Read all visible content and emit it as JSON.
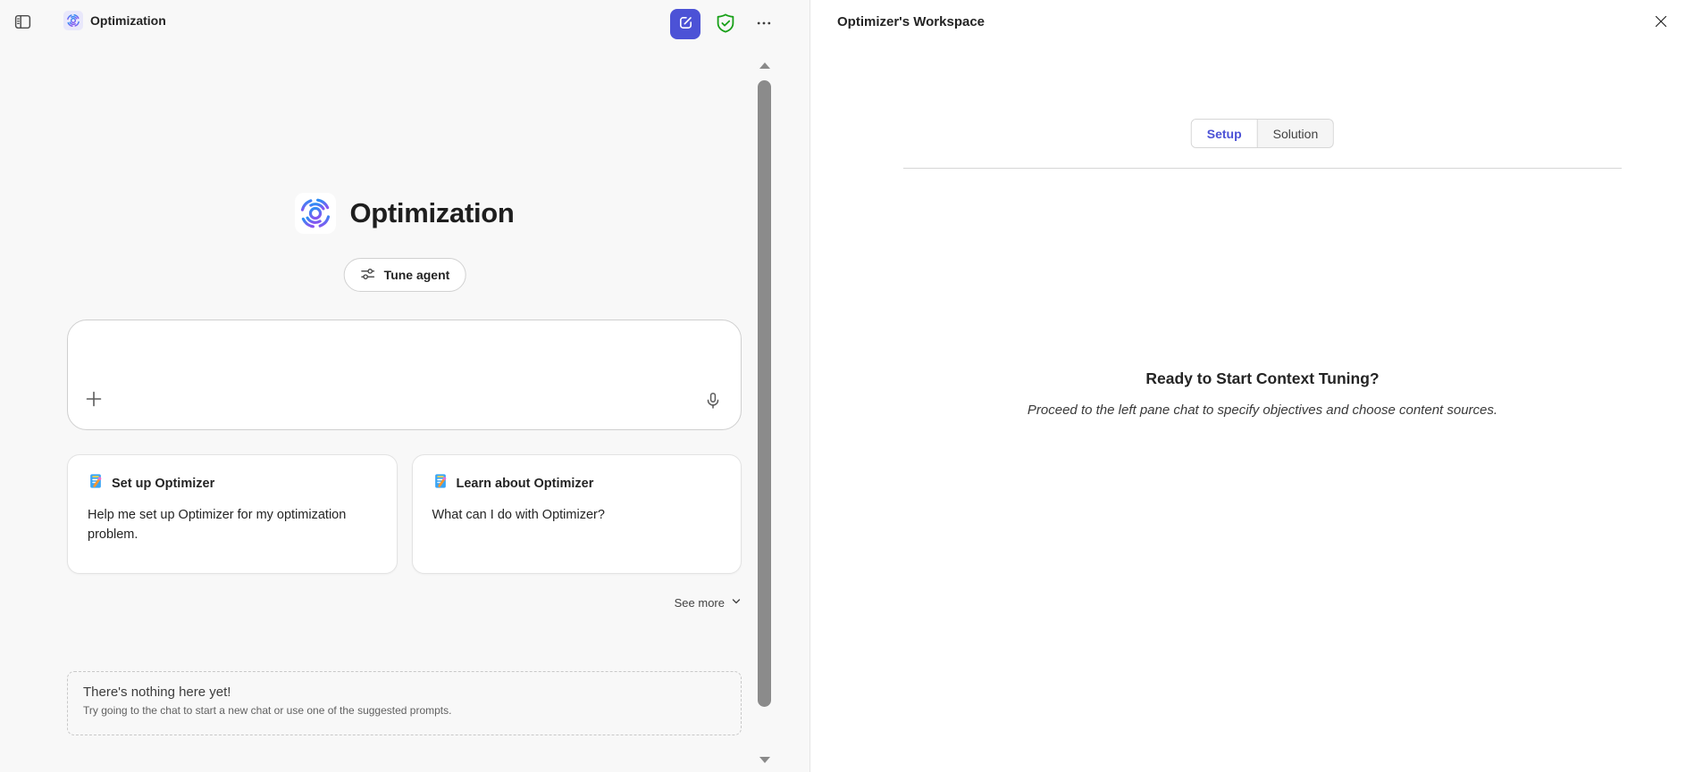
{
  "header": {
    "title": "Optimization"
  },
  "main": {
    "agent_title": "Optimization",
    "tune_agent_label": "Tune agent",
    "suggestions": [
      {
        "title": "Set up Optimizer",
        "body": "Help me set up Optimizer for my optimization problem."
      },
      {
        "title": "Learn about Optimizer",
        "body": "What can I do with Optimizer?"
      }
    ],
    "see_more_label": "See more",
    "empty_state": {
      "title": "There's nothing here yet!",
      "subtitle": "Try going to the chat to start a new chat or use one of the suggested prompts."
    }
  },
  "workspace": {
    "title": "Optimizer's Workspace",
    "tabs": [
      {
        "label": "Setup",
        "active": true
      },
      {
        "label": "Solution",
        "active": false
      }
    ],
    "ready_title": "Ready to Start Context Tuning?",
    "ready_subtitle": "Proceed to the left pane chat to specify objectives and choose content sources."
  },
  "icons": {
    "sidebar_toggle": "panel-left-icon",
    "agent": "gradient-swirl-icon",
    "new_chat": "compose-pencil-icon",
    "shield": "shield-checkmark-icon",
    "more": "ellipsis-icon",
    "tune": "sliders-icon",
    "plus": "plus-icon",
    "mic": "microphone-icon",
    "suggestion": "memo-clipboard-icon",
    "see_more": "chevron-down-icon",
    "close": "close-x-icon"
  },
  "colors": {
    "accent": "#4c52d6",
    "success": "#18a018",
    "pane_background": "#f8f8f8",
    "scrollbar_thumb": "#8b8b8b",
    "text_primary": "#242424",
    "text_secondary": "#616161"
  }
}
